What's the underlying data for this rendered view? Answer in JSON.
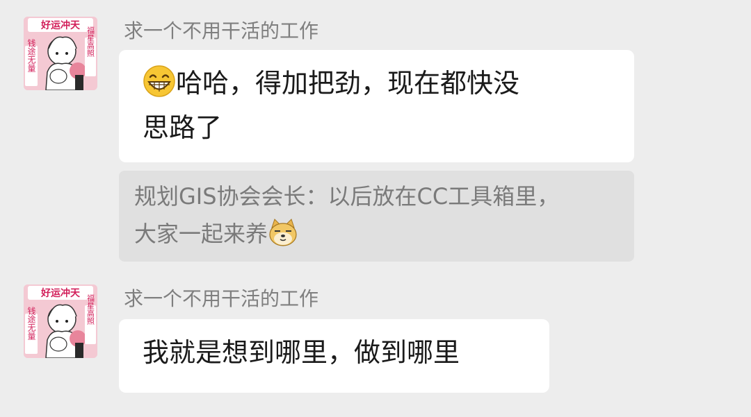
{
  "messages": [
    {
      "avatar": {
        "top_text": "好运冲天",
        "left_text": "钱途无量",
        "right_text": "福星高照"
      },
      "sender": "求一个不用干活的工作",
      "emoji": "grinning-emoji",
      "text_line1": "哈哈，得加把劲，现在都快没",
      "text_line2": "思路了",
      "quote": {
        "line1": "规划GIS协会会长：以后放在CC工具箱里，",
        "line2": "大家一起来养",
        "emoji": "doge-emoji"
      }
    },
    {
      "avatar": {
        "top_text": "好运冲天",
        "left_text": "钱途无量",
        "right_text": "福星高照"
      },
      "sender": "求一个不用干活的工作",
      "text": "我就是想到哪里，做到哪里"
    }
  ]
}
